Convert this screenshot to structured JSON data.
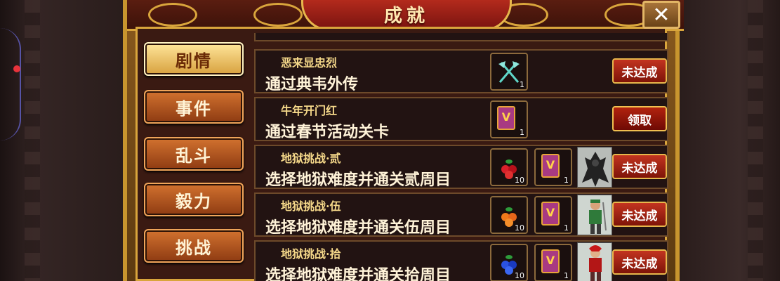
{
  "window": {
    "title": "成就",
    "close_glyph": "✕"
  },
  "tabs": [
    {
      "label": "剧情",
      "active": true
    },
    {
      "label": "事件",
      "active": false
    },
    {
      "label": "乱斗",
      "active": false
    },
    {
      "label": "毅力",
      "active": false
    },
    {
      "label": "挑战",
      "active": false
    }
  ],
  "achievements": [
    {
      "title": "恶来显忠烈",
      "description": "通过典韦外传",
      "rewards": [
        {
          "icon": "crossed-axes-icon",
          "count": "1"
        }
      ],
      "action": "未达成"
    },
    {
      "title": "牛年开门红",
      "description": "通过春节活动关卡",
      "rewards": [
        {
          "icon": "purple-book-icon",
          "count": "1"
        }
      ],
      "action": "领取"
    },
    {
      "title": "地狱挑战·贰",
      "description": "选择地狱难度并通关贰周目",
      "rewards": [
        {
          "icon": "red-fruit-icon",
          "count": "10"
        },
        {
          "icon": "purple-book-icon",
          "count": "1"
        },
        {
          "icon": "dark-demon-avatar-icon",
          "count": ""
        }
      ],
      "action": "未达成"
    },
    {
      "title": "地狱挑战·伍",
      "description": "选择地狱难度并通关伍周目",
      "rewards": [
        {
          "icon": "orange-fruit-icon",
          "count": "10"
        },
        {
          "icon": "purple-book-icon",
          "count": "1"
        },
        {
          "icon": "green-warrior-avatar-icon",
          "count": ""
        }
      ],
      "action": "未达成"
    },
    {
      "title": "地狱挑战·拾",
      "description": "选择地狱难度并通关拾周目",
      "rewards": [
        {
          "icon": "blue-fruit-icon",
          "count": "10"
        },
        {
          "icon": "purple-book-icon",
          "count": "1"
        },
        {
          "icon": "red-warrior-avatar-icon",
          "count": ""
        }
      ],
      "action": "未达成"
    }
  ],
  "colors": {
    "panel_gold": "#d9a53c",
    "row_bg": "#221312",
    "title_gold": "#f6d98a",
    "button_red": "#c23420"
  }
}
